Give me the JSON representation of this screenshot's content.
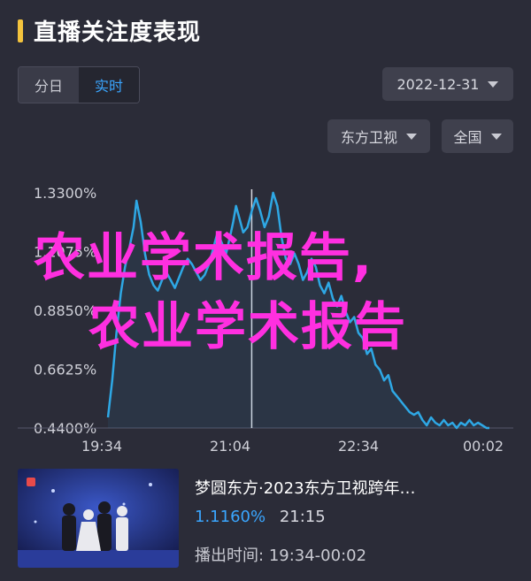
{
  "header": {
    "title": "直播关注度表现"
  },
  "segment": {
    "options": [
      "分日",
      "实时"
    ],
    "active": "实时"
  },
  "filters": {
    "date": "2022-12-31",
    "channel": "东方卫视",
    "region": "全国"
  },
  "watermark": {
    "line1": "农业学术报告,",
    "line2": "农业学术报告"
  },
  "program": {
    "title": "梦圆东方·2023东方卫视跨年…",
    "rate": "1.1160%",
    "time": "21:15",
    "airtime_label": "播出时间:",
    "airtime_value": "19:34-00:02"
  },
  "colors": {
    "line": "#2ea8e5",
    "accent": "#3aa6ff",
    "title_mark": "#f3c33d",
    "watermark": "#ff2fe0"
  },
  "chart_data": {
    "type": "area",
    "xlabel": "",
    "ylabel": "",
    "x_ticks": [
      "19:34",
      "21:04",
      "22:34",
      "00:02"
    ],
    "y_ticks": [
      "0.4400%",
      "0.6625%",
      "0.8850%",
      "1.1075%",
      "1.3300%"
    ],
    "ylim": [
      0.44,
      1.33
    ],
    "xlim_minutes_from_start": [
      0,
      268
    ],
    "series": [
      {
        "x": [
          0,
          3,
          6,
          9,
          12,
          15,
          18,
          20,
          23,
          26,
          29,
          32,
          35,
          38,
          41,
          44,
          47,
          50,
          53,
          56,
          59,
          62,
          65,
          68,
          71,
          74,
          77,
          80,
          83,
          86,
          88,
          90,
          92,
          95,
          98,
          101,
          104,
          107,
          110,
          113,
          116,
          119,
          122,
          125,
          128,
          131,
          134,
          137,
          140,
          143,
          146,
          149,
          152,
          155,
          158,
          161,
          164,
          167,
          170,
          173,
          176,
          179,
          182,
          185,
          188,
          191,
          194,
          197,
          200,
          203,
          206,
          209,
          212,
          215,
          218,
          221,
          224,
          227,
          230,
          233,
          236,
          239,
          242,
          245,
          248,
          251,
          254,
          257,
          260,
          263,
          266,
          268
        ],
        "values": [
          0.48,
          0.62,
          0.8,
          0.95,
          1.05,
          1.12,
          1.2,
          1.3,
          1.22,
          1.1,
          1.02,
          0.98,
          0.96,
          1.0,
          1.03,
          1.0,
          0.97,
          1.01,
          1.05,
          1.08,
          1.06,
          1.03,
          1.0,
          1.02,
          1.06,
          1.12,
          1.18,
          1.14,
          1.1,
          1.17,
          1.22,
          1.28,
          1.24,
          1.18,
          1.2,
          1.26,
          1.31,
          1.26,
          1.2,
          1.24,
          1.33,
          1.28,
          1.16,
          1.08,
          1.06,
          1.1,
          1.06,
          1.0,
          1.03,
          1.08,
          1.05,
          0.98,
          0.95,
          0.99,
          0.93,
          0.9,
          0.94,
          0.88,
          0.84,
          0.86,
          0.8,
          0.78,
          0.72,
          0.74,
          0.68,
          0.66,
          0.62,
          0.64,
          0.58,
          0.56,
          0.54,
          0.52,
          0.5,
          0.49,
          0.5,
          0.47,
          0.45,
          0.48,
          0.46,
          0.45,
          0.47,
          0.45,
          0.46,
          0.44,
          0.46,
          0.45,
          0.47,
          0.45,
          0.46,
          0.45,
          0.44,
          0.44
        ]
      }
    ],
    "cursor_x": 101,
    "grid": false
  }
}
